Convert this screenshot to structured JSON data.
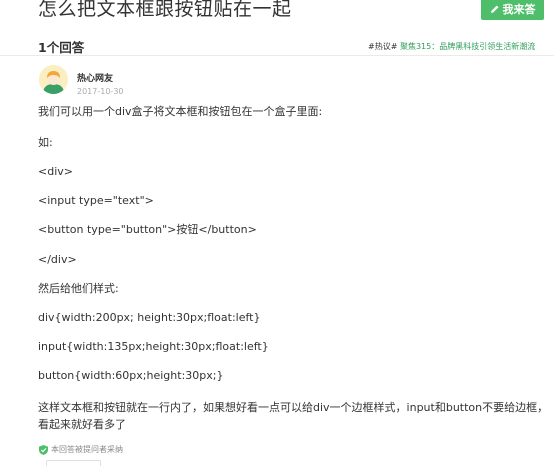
{
  "question": {
    "title": "怎么把文本框跟按钮贴在一起",
    "answer_button_label": "我来答"
  },
  "answers_header": {
    "count_label": "1个回答",
    "hot_prefix": "#热议#",
    "hot_link": "聚焦315：品牌黑科技引领生活新潮流"
  },
  "answer": {
    "user_name": "热心网友",
    "date": "2017-10-30",
    "paragraphs": [
      "我们可以用一个div盒子将文本框和按钮包在一个盒子里面:",
      "如:",
      "<div>",
      "<input type=\"text\">",
      "<button type=\"button\">按钮</button>",
      "</div>",
      "然后给他们样式:",
      "div{width:200px; height:30px;float:left}",
      "input{width:135px;height:30px;float:left}",
      "button{width:60px;height:30px;}",
      "这样文本框和按钮就在一行内了，如果想好看一点可以给div一个边框样式，input和button不要给边框，看起来就好看多了"
    ],
    "adopted_label": "本回答被提问者采纳"
  },
  "colors": {
    "brand_green": "#4fbe6b",
    "link_green": "#2e9e5a"
  },
  "icons": {
    "answer_button": "pencil-icon",
    "adopted": "shield-check-icon",
    "avatar": "user-avatar"
  }
}
